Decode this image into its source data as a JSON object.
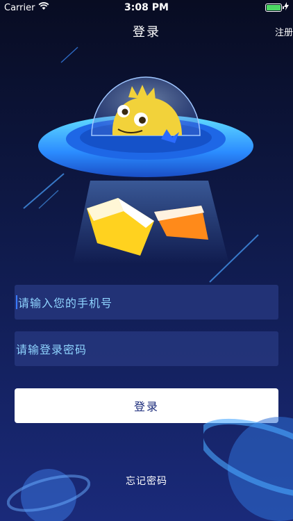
{
  "status_bar": {
    "carrier": "Carrier",
    "time": "3:08 PM"
  },
  "nav": {
    "title": "登录",
    "register_label": "注册"
  },
  "form": {
    "phone_placeholder": "请输入您的手机号",
    "password_placeholder": "请输登录密码",
    "login_label": "登录",
    "forgot_label": "忘记密码"
  },
  "colors": {
    "background_top": "#080c22",
    "background_bottom": "#1a2a7a",
    "field_background": "#283a82",
    "placeholder_text": "#8fd4ff",
    "button_background": "#ffffff",
    "button_text": "#1a2a7a",
    "battery": "#4cd964"
  },
  "icons": [
    "wifi-icon",
    "battery-icon",
    "charging-icon",
    "ufo-dinosaur-illustration",
    "book-icon",
    "planet-decoration"
  ]
}
